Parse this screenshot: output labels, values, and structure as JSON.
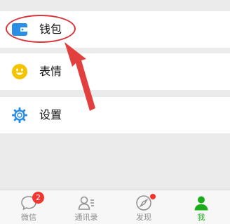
{
  "menu": {
    "items": [
      {
        "label": "钱包",
        "icon": "wallet-icon"
      },
      {
        "label": "表情",
        "icon": "emoji-icon"
      },
      {
        "label": "设置",
        "icon": "settings-gear-icon"
      }
    ]
  },
  "tabbar": {
    "tabs": [
      {
        "label": "微信",
        "icon": "chat-bubble-icon",
        "badge": "2"
      },
      {
        "label": "通讯录",
        "icon": "contacts-icon"
      },
      {
        "label": "发现",
        "icon": "compass-icon",
        "dot": true
      },
      {
        "label": "我",
        "icon": "person-icon",
        "active": true
      }
    ]
  },
  "colors": {
    "accent": "#1aad19",
    "badge": "#f43530",
    "annotation": "#d8343a",
    "wallet_icon": "#2a8ee6",
    "emoji_icon": "#f5c400",
    "settings_icon": "#2a8ee6"
  }
}
